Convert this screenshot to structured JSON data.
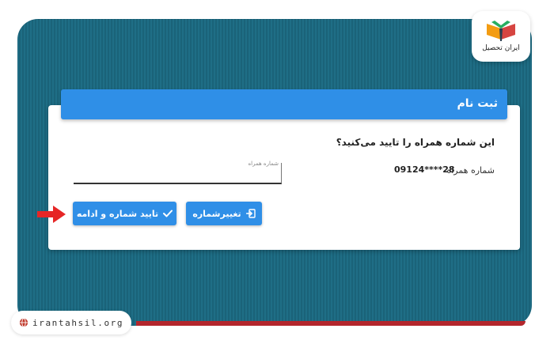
{
  "brand": {
    "logo_text": "ایران تحصیل",
    "website": "irantahsil.org",
    "accent_color": "#2f8fe7",
    "frame_color": "#1f6e86",
    "footer_line_color": "#b3262c"
  },
  "form": {
    "title": "ثبت نام",
    "question": "این شماره همراه را تایید می‌کنید؟",
    "phone_label": "شماره همراه",
    "phone_value": "09124****28",
    "input_label": "شماره همراه",
    "input_value": ""
  },
  "buttons": {
    "confirm_label": "تایید شماره و ادامه",
    "change_label": "تغییرشماره"
  },
  "icons": {
    "confirm": "check-icon",
    "change": "login-icon",
    "pointer": "arrow-right-icon",
    "footer": "globe-icon"
  }
}
